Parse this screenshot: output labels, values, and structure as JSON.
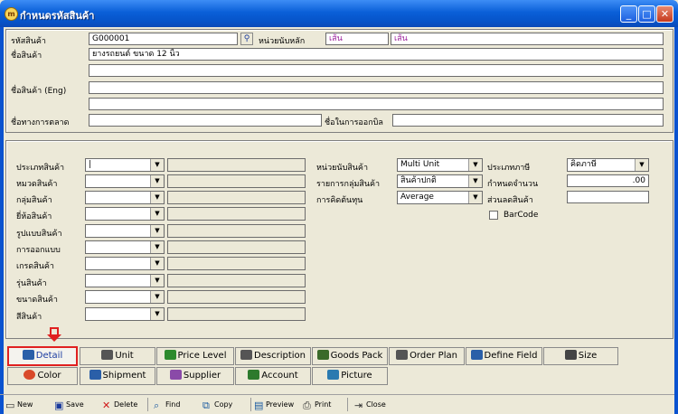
{
  "window": {
    "title": "กำหนดรหัสสินค้า"
  },
  "header": {
    "code_label": "รหัสสินค้า",
    "code_value": "G000001",
    "unit_label": "หน่วยนับหลัก",
    "unit_value1": "เส้น",
    "unit_value2": "เส้น",
    "name_label": "ชื่อสินค้า",
    "name_value": "ยางรถยนต์ ขนาด 12 นิ้ว",
    "name_eng_label": "ชื่อสินค้า (Eng)",
    "market_name_label": "ชื่อทางการตลาด",
    "bill_name_label": "ชื่อในการออกบิล"
  },
  "details": {
    "left_labels": [
      "ประเภทสินค้า",
      "หมวดสินค้า",
      "กลุ่มสินค้า",
      "ยี่ห้อสินค้า",
      "รูปแบบสินค้า",
      "การออกแบบ",
      "เกรดสินค้า",
      "รุ่นสินค้า",
      "ขนาดสินค้า",
      "สีสินค้า"
    ],
    "first_value": "|",
    "mid_labels": [
      "หน่วยนับสินค้า",
      "รายการกลุ่มสินค้า",
      "การคิดต้นทุน"
    ],
    "mid_values": [
      "Multi Unit",
      "สินค้าปกติ",
      "Average"
    ],
    "right_labels": [
      "ประเภทภาษี",
      "กำหนดจำนวน",
      "ส่วนลดสินค้า"
    ],
    "tax_value": "คิดภาษี",
    "amount_value": ".00",
    "barcode_label": "BarCode"
  },
  "tabs_row1": [
    "Detail",
    "Unit",
    "Price Level",
    "Description",
    "Goods Pack",
    "Order Plan",
    "Define Field",
    "Size"
  ],
  "tabs_row2": [
    "Color",
    "Shipment",
    "Supplier",
    "Account",
    "Picture"
  ],
  "toolbar": [
    "New",
    "Save",
    "Delete",
    "Find",
    "Copy",
    "Preview",
    "Print",
    "Close"
  ],
  "colors": {
    "titlebar": "#0a5fd8",
    "frame": "#0a52cf",
    "highlight": "#e02020",
    "unit_text": "#9b1f9b"
  }
}
